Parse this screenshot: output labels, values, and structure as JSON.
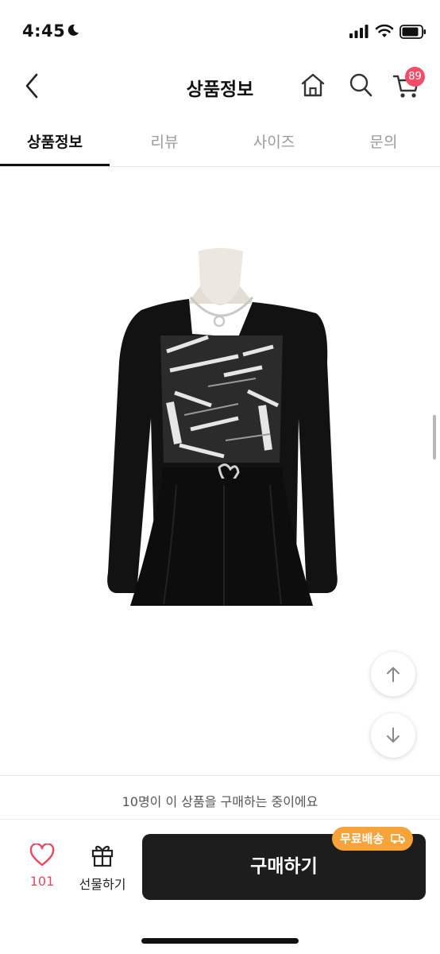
{
  "status_bar": {
    "time": "4:45"
  },
  "header": {
    "title": "상품정보",
    "cart_count": "89"
  },
  "tabs": [
    {
      "label": "상품정보",
      "active": true
    },
    {
      "label": "리뷰",
      "active": false
    },
    {
      "label": "사이즈",
      "active": false
    },
    {
      "label": "문의",
      "active": false
    }
  ],
  "product": {
    "viewers_notice": "10명이 이 상품을 구매하는 중이에요"
  },
  "bottom_bar": {
    "like_count": "101",
    "gift_label": "선물하기",
    "buy_label": "구매하기",
    "free_shipping_badge": "무료배송"
  },
  "colors": {
    "accent_pink": "#f24d66",
    "badge_orange": "#f6a33a",
    "buy_button": "#1d1d1d"
  }
}
